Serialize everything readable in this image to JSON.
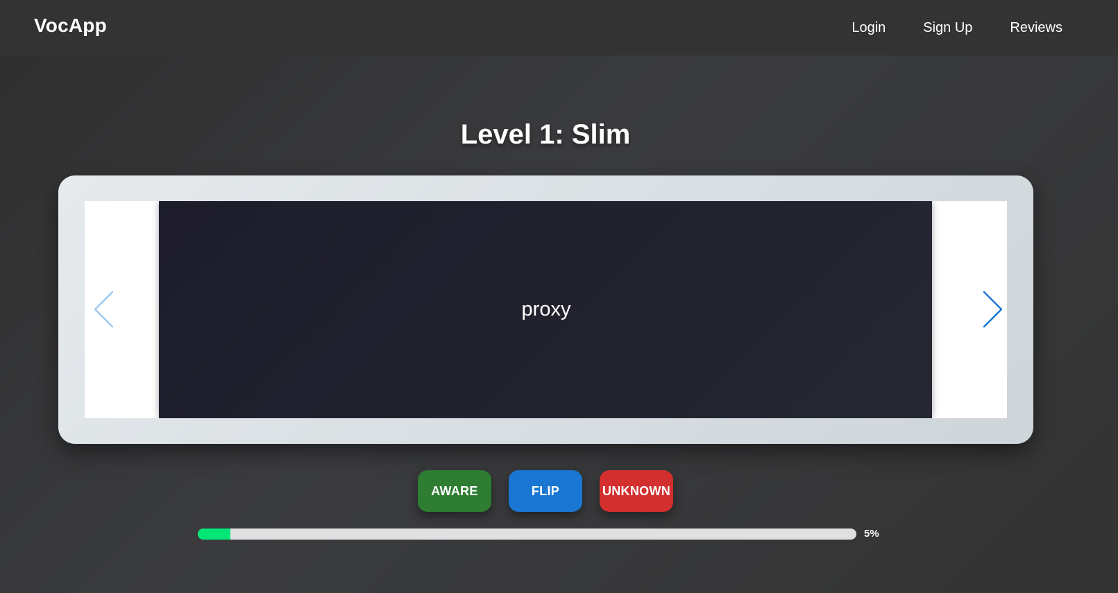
{
  "brand": "VocApp",
  "nav": {
    "items": [
      {
        "label": "Login"
      },
      {
        "label": "Sign Up"
      },
      {
        "label": "Reviews"
      }
    ]
  },
  "level_title": "Level 1: Slim",
  "card": {
    "word": "proxy"
  },
  "carousel": {
    "prev_icon": "chevron-left-icon",
    "next_icon": "chevron-right-icon",
    "prev_color": "#9ec9f3",
    "next_color": "#1976d2"
  },
  "actions": {
    "aware_label": "AWARE",
    "flip_label": "FLIP",
    "unknown_label": "UNKNOWN"
  },
  "progress": {
    "percent": 5,
    "label": "5%",
    "fill_color": "#00e676"
  },
  "colors": {
    "aware": "#2e7d32",
    "flip": "#1976d2",
    "unknown": "#d32f2f"
  }
}
